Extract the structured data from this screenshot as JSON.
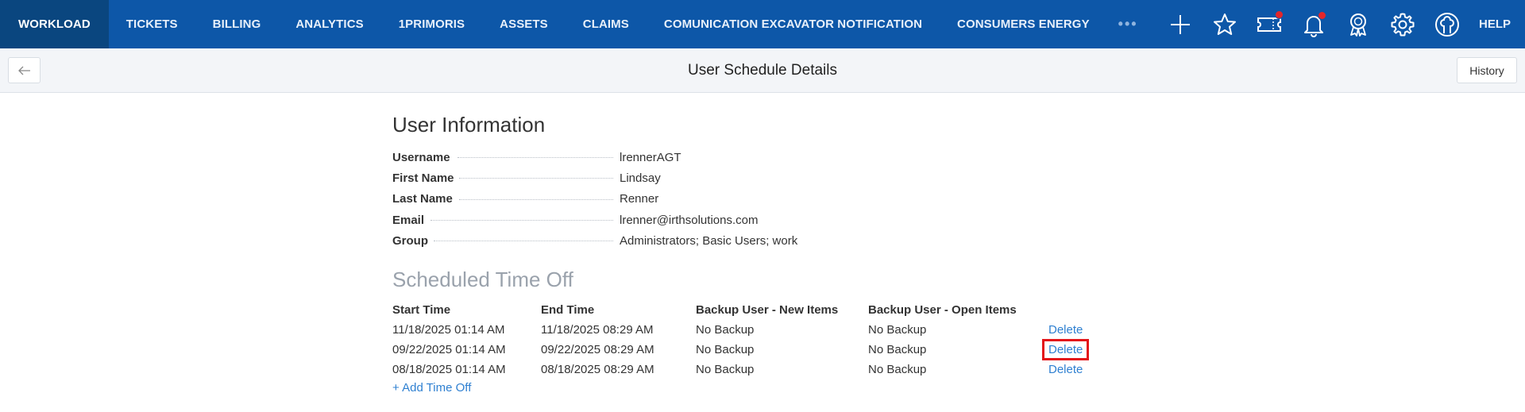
{
  "nav": {
    "items": [
      "WORKLOAD",
      "TICKETS",
      "BILLING",
      "ANALYTICS",
      "1PRIMORIS",
      "ASSETS",
      "CLAIMS",
      "COMUNICATION EXCAVATOR NOTIFICATION",
      "CONSUMERS ENERGY"
    ],
    "more": "•••",
    "help": "HELP",
    "icons": [
      "plus-icon",
      "star-icon",
      "ticket-icon",
      "bell-icon",
      "award-icon",
      "gear-icon",
      "user-icon"
    ],
    "accent": "#0d57a8",
    "badge_color": "#e3262a"
  },
  "header": {
    "title": "User Schedule Details",
    "history": "History"
  },
  "user_info": {
    "heading": "User Information",
    "rows": [
      {
        "label": "Username",
        "value": "lrennerAGT"
      },
      {
        "label": "First Name",
        "value": "Lindsay"
      },
      {
        "label": "Last Name",
        "value": "Renner"
      },
      {
        "label": "Email",
        "value": "lrenner@irthsolutions.com"
      },
      {
        "label": "Group",
        "value": "Administrators; Basic Users; work"
      }
    ]
  },
  "schedule": {
    "heading": "Scheduled Time Off",
    "columns": [
      "Start Time",
      "End Time",
      "Backup User - New Items",
      "Backup User - Open Items"
    ],
    "rows": [
      {
        "start": "11/18/2025 01:14 AM",
        "end": "11/18/2025 08:29 AM",
        "new_items": "No Backup",
        "open_items": "No Backup",
        "action": "Delete"
      },
      {
        "start": "09/22/2025 01:14 AM",
        "end": "09/22/2025 08:29 AM",
        "new_items": "No Backup",
        "open_items": "No Backup",
        "action": "Delete"
      },
      {
        "start": "08/18/2025 01:14 AM",
        "end": "08/18/2025 08:29 AM",
        "new_items": "No Backup",
        "open_items": "No Backup",
        "action": "Delete"
      }
    ],
    "add_label": "+ Add Time Off"
  }
}
